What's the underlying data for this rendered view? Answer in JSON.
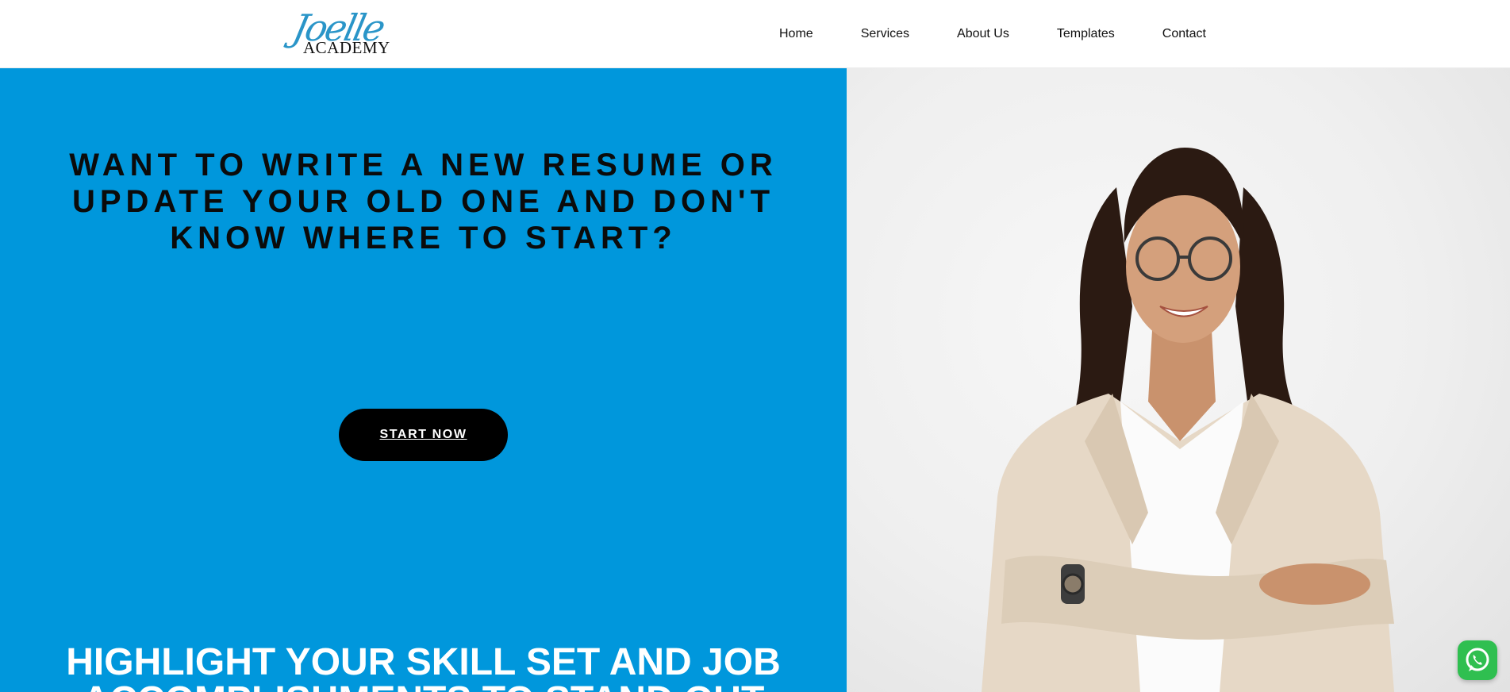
{
  "brand": {
    "logo_script": "Joelle",
    "logo_text": "ACADEMY",
    "script_color": "#2a95c8"
  },
  "nav": {
    "items": [
      {
        "label": "Home"
      },
      {
        "label": "Services"
      },
      {
        "label": "About Us"
      },
      {
        "label": "Templates"
      },
      {
        "label": "Contact"
      }
    ]
  },
  "hero": {
    "question": "WANT TO WRITE A NEW RESUME OR UPDATE YOUR OLD ONE AND DON'T KNOW WHERE TO START?",
    "cta_label": "START NOW",
    "highlight": "HIGHLIGHT YOUR SKILL SET AND JOB ACCOMPLISHMENTS TO STAND OUT",
    "panel_color": "#0097dc",
    "highlight_color": "#ffffff"
  },
  "floating": {
    "icon": "whatsapp-icon",
    "color": "#2fbf50"
  }
}
